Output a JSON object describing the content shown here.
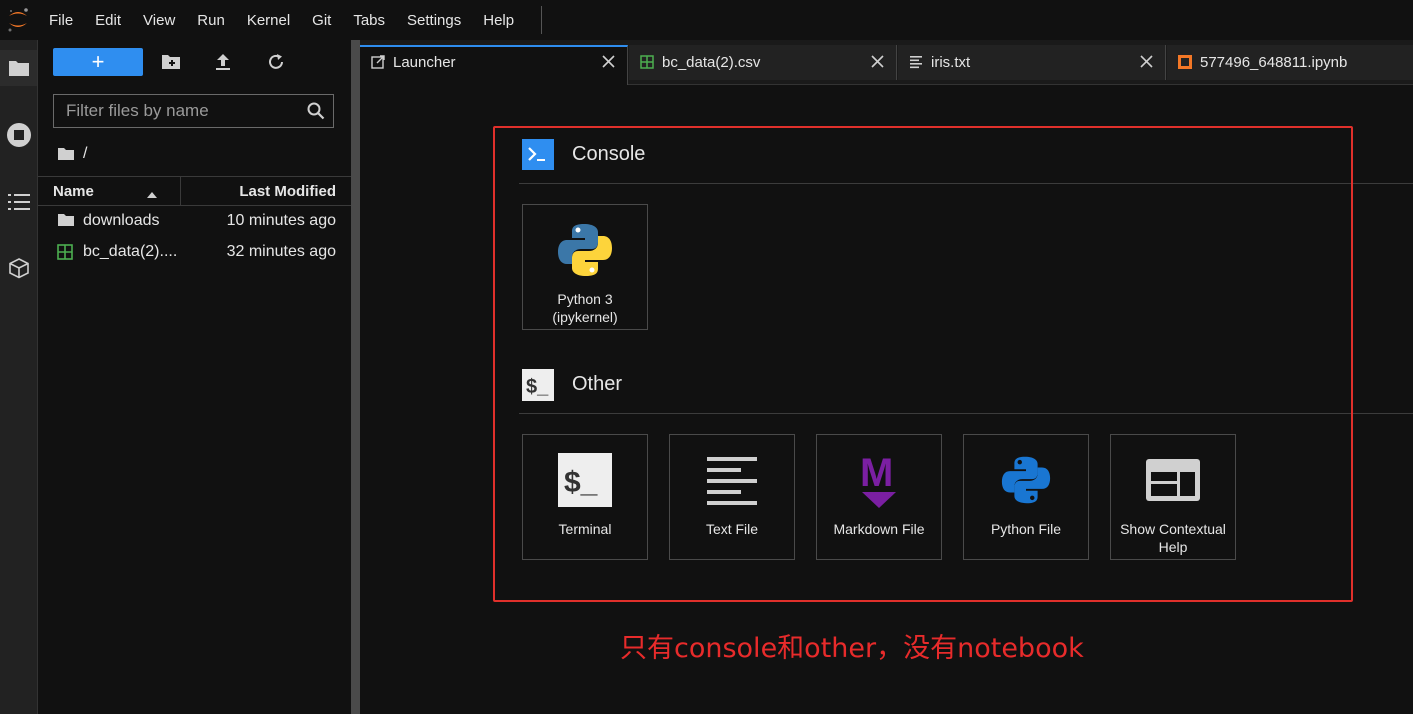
{
  "menubar": {
    "items": [
      "File",
      "Edit",
      "View",
      "Run",
      "Kernel",
      "Git",
      "Tabs",
      "Settings",
      "Help"
    ]
  },
  "activity_bar": {
    "icons": [
      "folder-icon",
      "running-icon",
      "toc-icon",
      "extension-icon"
    ]
  },
  "file_browser": {
    "new_button_label": "+",
    "filter_placeholder": "Filter files by name",
    "breadcrumb": "/",
    "columns": {
      "name": "Name",
      "last_modified": "Last Modified"
    },
    "files": [
      {
        "name": "downloads",
        "modified": "10 minutes ago",
        "icon": "folder-icon"
      },
      {
        "name": "bc_data(2)....",
        "modified": "32 minutes ago",
        "icon": "csv-file-icon"
      }
    ]
  },
  "tabs": [
    {
      "label": "Launcher",
      "icon": "launcher-icon",
      "active": true,
      "closable": true
    },
    {
      "label": "bc_data(2).csv",
      "icon": "csv-file-icon",
      "active": false,
      "closable": true
    },
    {
      "label": "iris.txt",
      "icon": "text-file-icon",
      "active": false,
      "closable": true
    },
    {
      "label": "577496_648811.ipynb",
      "icon": "notebook-icon",
      "active": false,
      "closable": false
    }
  ],
  "launcher": {
    "console": {
      "title": "Console",
      "cards": [
        {
          "label": "Python 3\n(ipykernel)",
          "line1": "Python 3",
          "line2": "(ipykernel)",
          "icon": "python-logo-icon"
        }
      ]
    },
    "other": {
      "title": "Other",
      "cards": [
        {
          "label": "Terminal",
          "icon": "terminal-icon"
        },
        {
          "label": "Text File",
          "icon": "text-file-icon"
        },
        {
          "label": "Markdown File",
          "icon": "markdown-icon"
        },
        {
          "label": "Python File",
          "icon": "python-file-icon"
        },
        {
          "label": "Show Contextual Help",
          "line1": "Show Contextual",
          "line2": "Help",
          "icon": "contextual-help-icon"
        }
      ]
    }
  },
  "annotation": "只有console和other，没有notebook",
  "colors": {
    "accent": "#2f8ef0",
    "annotation_red": "#e82b2b",
    "background": "#111111"
  }
}
